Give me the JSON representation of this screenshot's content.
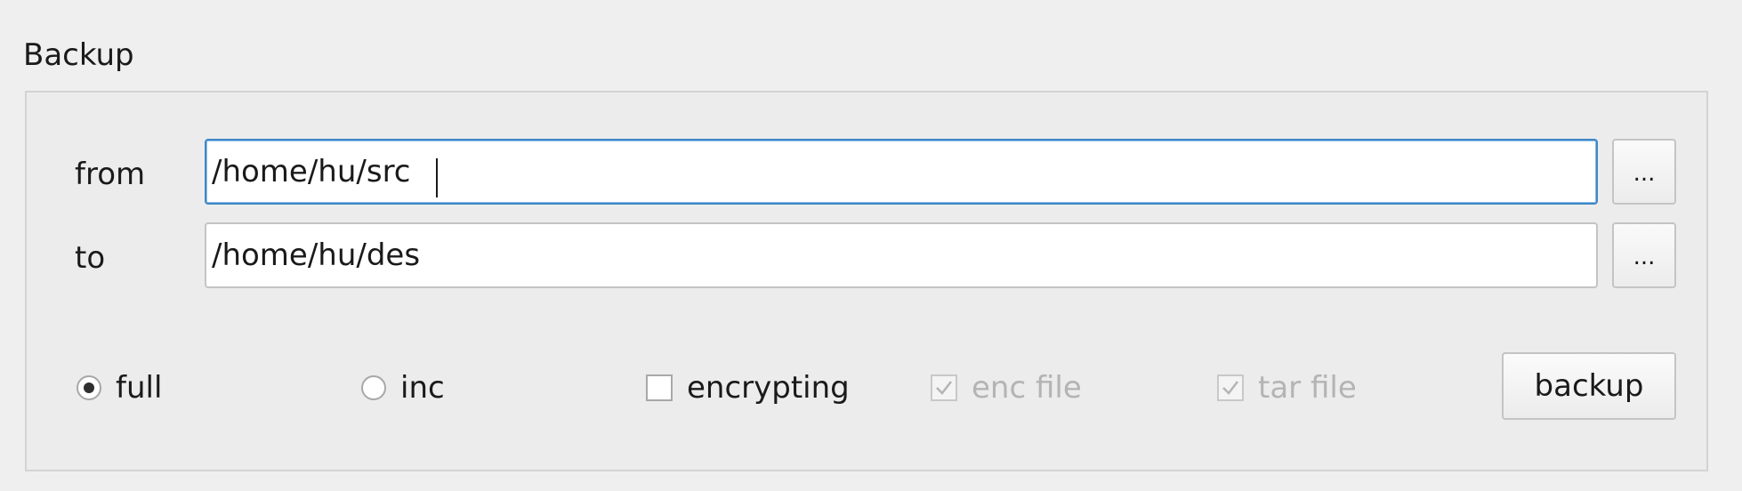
{
  "group": {
    "title": "Backup"
  },
  "source": {
    "label": "from",
    "value": "/home/hu/src",
    "browse_label": "..."
  },
  "destination": {
    "label": "to",
    "value": "/home/hu/des",
    "browse_label": "..."
  },
  "options": {
    "full": {
      "label": "full",
      "selected": true
    },
    "inc": {
      "label": "inc",
      "selected": false
    },
    "encrypting": {
      "label": "encrypting",
      "checked": false
    },
    "enc_file": {
      "label": "enc file",
      "checked": true,
      "disabled": true
    },
    "tar_file": {
      "label": "tar file",
      "checked": true,
      "disabled": true
    }
  },
  "actions": {
    "backup_label": "backup"
  },
  "colors": {
    "focus_border": "#3d87c8",
    "disabled_text": "#b4b4b4",
    "background": "#efefef"
  },
  "icons": {
    "radio_selected": "radio-selected-icon",
    "radio_unselected": "radio-unselected-icon",
    "checkbox_checked": "checkmark-icon"
  }
}
